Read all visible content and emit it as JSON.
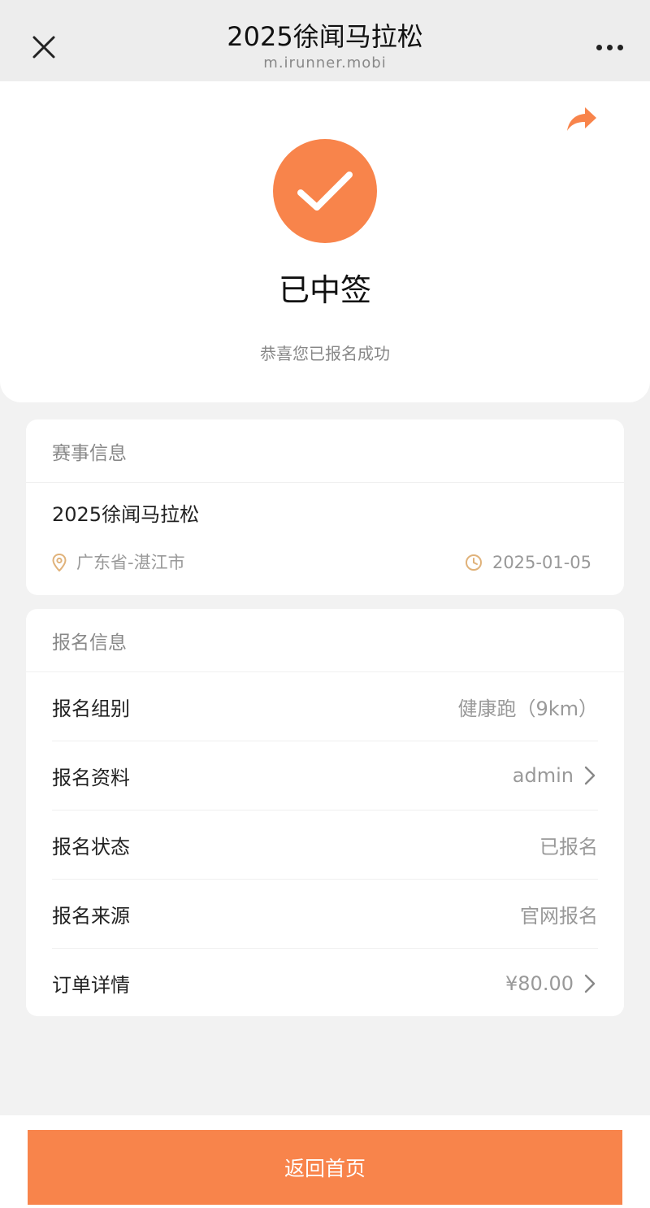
{
  "navbar": {
    "title": "2025徐闻马拉松",
    "subtitle": "m.irunner.mobi",
    "close_icon": "close-icon",
    "more_icon": "more-icon"
  },
  "status": {
    "icon": "check-icon",
    "title": "已中签",
    "message": "恭喜您已报名成功",
    "share_icon": "share-icon"
  },
  "event_info": {
    "header": "赛事信息",
    "name": "2025徐闻马拉松",
    "location": "广东省-湛江市",
    "date": "2025-01-05"
  },
  "registration": {
    "header": "报名信息",
    "rows": [
      {
        "label": "报名组别",
        "value": "健康跑（9km）",
        "chevron": false
      },
      {
        "label": "报名资料",
        "value": "admin",
        "chevron": true
      },
      {
        "label": "报名状态",
        "value": "已报名",
        "chevron": false
      },
      {
        "label": "报名来源",
        "value": "官网报名",
        "chevron": false
      },
      {
        "label": "订单详情",
        "value": "¥80.00",
        "chevron": true
      }
    ]
  },
  "bottom": {
    "home_label": "返回首页"
  },
  "colors": {
    "accent": "#f8844b",
    "meta_icon": "#e0b27a"
  }
}
